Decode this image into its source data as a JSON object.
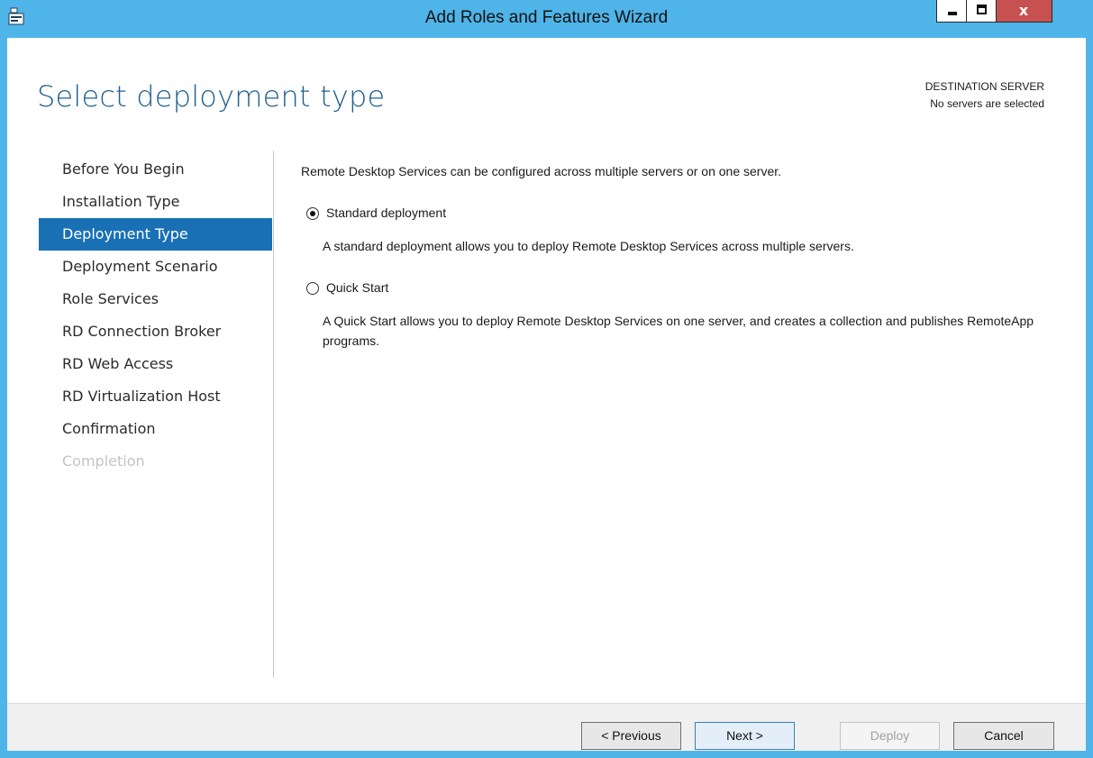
{
  "window": {
    "title": "Add Roles and Features Wizard",
    "close_label": "x",
    "colors": {
      "frame": "#4fb4e8",
      "accent": "#1a70b5",
      "close": "#c75050"
    }
  },
  "header": {
    "page_title": "Select deployment type",
    "destination_label": "DESTINATION SERVER",
    "destination_value": "No servers are selected"
  },
  "nav": {
    "items": [
      {
        "label": "Before You Begin",
        "state": "normal"
      },
      {
        "label": "Installation Type",
        "state": "normal"
      },
      {
        "label": "Deployment Type",
        "state": "selected"
      },
      {
        "label": "Deployment Scenario",
        "state": "normal"
      },
      {
        "label": "Role Services",
        "state": "normal"
      },
      {
        "label": "RD Connection Broker",
        "state": "normal"
      },
      {
        "label": "RD Web Access",
        "state": "normal"
      },
      {
        "label": "RD Virtualization Host",
        "state": "normal"
      },
      {
        "label": "Confirmation",
        "state": "normal"
      },
      {
        "label": "Completion",
        "state": "disabled"
      }
    ]
  },
  "content": {
    "intro": "Remote Desktop Services can be configured across multiple servers or on one server.",
    "options": [
      {
        "label": "Standard deployment",
        "selected": true,
        "description": "A standard deployment allows you to deploy Remote Desktop Services across multiple servers."
      },
      {
        "label": "Quick Start",
        "selected": false,
        "description": "A Quick Start allows you to deploy Remote Desktop Services on one server, and creates a collection and publishes RemoteApp programs."
      }
    ]
  },
  "footer": {
    "previous_label": "< Previous",
    "next_label": "Next >",
    "deploy_label": "Deploy",
    "cancel_label": "Cancel"
  }
}
